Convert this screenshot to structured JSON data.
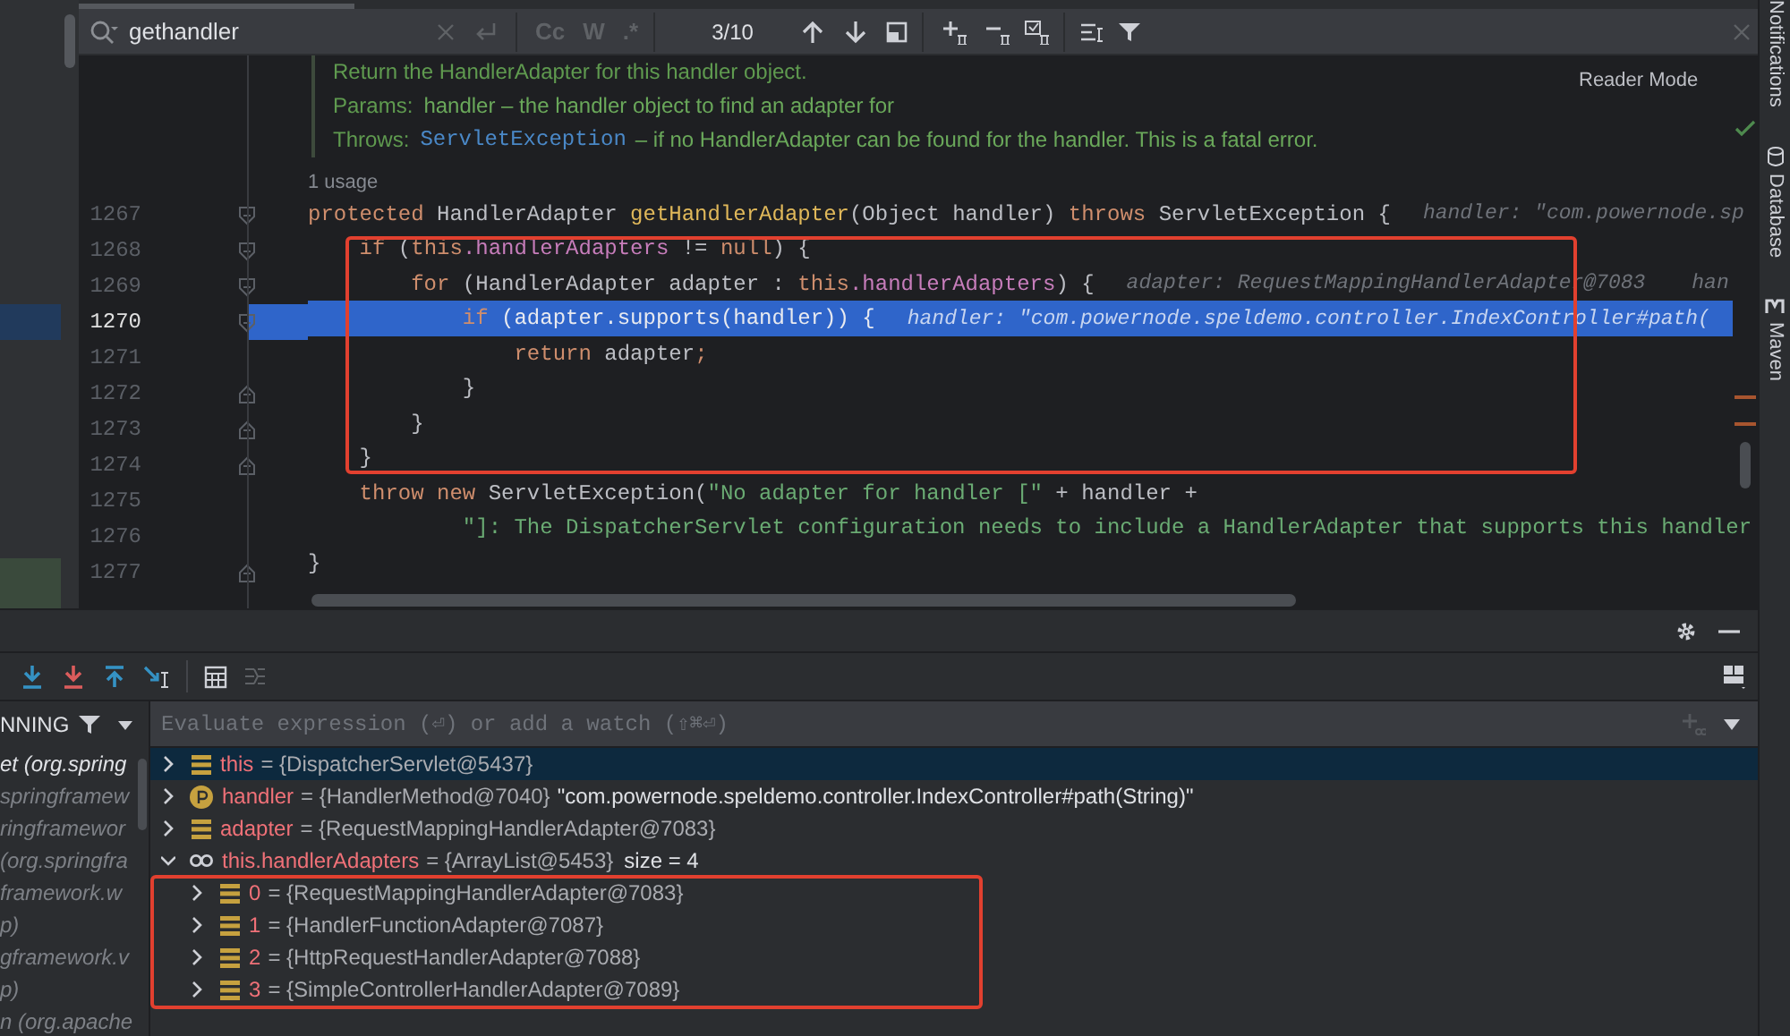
{
  "search": {
    "query": "gethandler",
    "toggles": [
      {
        "label": "Cc",
        "on": false
      },
      {
        "label": "W",
        "on": false
      },
      {
        "label": ".*",
        "on": false
      }
    ],
    "match_count": "3/10"
  },
  "reader_mode": "Reader Mode",
  "doc": {
    "summary": "Return the HandlerAdapter for this handler object.",
    "params_label": "Params:",
    "params_text": "handler – the handler object to find an adapter for",
    "throws_label": "Throws:",
    "throws_link": "ServletException",
    "throws_text": "– if no HandlerAdapter can be found for the handler. This is a fatal error."
  },
  "usages": "1 usage",
  "code_lines": [
    {
      "number": "1267",
      "selected": false,
      "block_start": true,
      "block_end": false,
      "tokens": [
        {
          "kind": "kw",
          "text": "protected "
        },
        {
          "kind": "plain",
          "text": "HandlerAdapter "
        },
        {
          "kind": "method",
          "text": "getHandlerAdapter"
        },
        {
          "kind": "plain",
          "text": "(Object handler) "
        },
        {
          "kind": "kw",
          "text": "throws "
        },
        {
          "kind": "plain",
          "text": "ServletException {"
        },
        {
          "kind": "hint",
          "text": "handler: \"com.powernode.sp"
        }
      ]
    },
    {
      "number": "1268",
      "selected": false,
      "block_start": true,
      "block_end": false,
      "tokens": [
        {
          "kind": "kw",
          "text": "    if "
        },
        {
          "kind": "plain",
          "text": "("
        },
        {
          "kind": "kw",
          "text": "this"
        },
        {
          "kind": "field",
          "text": ".handlerAdapters"
        },
        {
          "kind": "plain",
          "text": " != "
        },
        {
          "kind": "kw",
          "text": "null"
        },
        {
          "kind": "plain",
          "text": ") {"
        }
      ]
    },
    {
      "number": "1269",
      "selected": false,
      "block_start": true,
      "block_end": false,
      "tokens": [
        {
          "kind": "kw",
          "text": "        for "
        },
        {
          "kind": "plain",
          "text": "(HandlerAdapter adapter : "
        },
        {
          "kind": "kw",
          "text": "this"
        },
        {
          "kind": "field",
          "text": ".handlerAdapters"
        },
        {
          "kind": "plain",
          "text": ") {"
        },
        {
          "kind": "hint",
          "text": "adapter: RequestMappingHandlerAdapter@7083"
        },
        {
          "kind": "hint",
          "text": "han"
        }
      ]
    },
    {
      "number": "1270",
      "selected": true,
      "block_start": true,
      "block_end": false,
      "tokens": [
        {
          "kind": "kw",
          "text": "            if "
        },
        {
          "kind": "plain",
          "text": "(adapter.supports(handler)) {"
        },
        {
          "kind": "hint",
          "text": "handler: \"com.powernode.speldemo.controller.IndexController#path("
        }
      ]
    },
    {
      "number": "1271",
      "selected": false,
      "block_start": false,
      "block_end": false,
      "tokens": [
        {
          "kind": "kw",
          "text": "                return "
        },
        {
          "kind": "plain",
          "text": "adapter"
        },
        {
          "kind": "kw",
          "text": ";"
        }
      ]
    },
    {
      "number": "1272",
      "selected": false,
      "block_start": false,
      "block_end": true,
      "tokens": [
        {
          "kind": "plain",
          "text": "            }"
        }
      ]
    },
    {
      "number": "1273",
      "selected": false,
      "block_start": false,
      "block_end": true,
      "tokens": [
        {
          "kind": "plain",
          "text": "        }"
        }
      ]
    },
    {
      "number": "1274",
      "selected": false,
      "block_start": false,
      "block_end": true,
      "tokens": [
        {
          "kind": "plain",
          "text": "    }"
        }
      ]
    },
    {
      "number": "1275",
      "selected": false,
      "block_start": false,
      "block_end": false,
      "tokens": [
        {
          "kind": "kw",
          "text": "    throw new "
        },
        {
          "kind": "plain",
          "text": "ServletException("
        },
        {
          "kind": "str",
          "text": "\"No adapter for handler [\""
        },
        {
          "kind": "plain",
          "text": " + handler +"
        }
      ]
    },
    {
      "number": "1276",
      "selected": false,
      "block_start": false,
      "block_end": false,
      "tokens": [
        {
          "kind": "str",
          "text": "            \"]: The DispatcherServlet configuration needs to include a HandlerAdapter that supports this handler"
        }
      ]
    },
    {
      "number": "1277",
      "selected": false,
      "block_start": false,
      "block_end": true,
      "tokens": [
        {
          "kind": "plain",
          "text": "}"
        }
      ]
    }
  ],
  "side_tabs": [
    {
      "label": "Notifications",
      "kind": "bell"
    },
    {
      "label": "Database",
      "kind": "database"
    },
    {
      "label": "Maven",
      "kind": "maven"
    }
  ],
  "debugger": {
    "frames_header": "NNING",
    "frames": [
      {
        "text": "et (org.spring",
        "selected": true
      },
      {
        "text": "springframew",
        "selected": false
      },
      {
        "text": "ringframewor",
        "selected": false
      },
      {
        "text": "(org.springfra",
        "selected": false
      },
      {
        "text": "framework.w",
        "selected": false
      },
      {
        "text": "p)",
        "selected": false
      },
      {
        "text": "gframework.v",
        "selected": false
      },
      {
        "text": "p)",
        "selected": false
      },
      {
        "text": "n (org.apache",
        "selected": false
      }
    ],
    "watch_placeholder": "Evaluate expression (⏎) or add a watch (⇧⌘⏎)",
    "variables": [
      {
        "kind": "field",
        "name": "this",
        "value": "= {DispatcherServlet@5437}",
        "selected": true,
        "expanded": false
      },
      {
        "kind": "param",
        "name": "handler",
        "value": "= {HandlerMethod@7040}",
        "string": "\"com.powernode.speldemo.controller.IndexController#path(String)\"",
        "selected": false,
        "expanded": false
      },
      {
        "kind": "field",
        "name": "adapter",
        "value": "= {RequestMappingHandlerAdapter@7083}",
        "selected": false,
        "expanded": false
      },
      {
        "kind": "list",
        "name": "this.handlerAdapters",
        "value": "= {ArrayList@5453}",
        "size": "size = 4",
        "selected": false,
        "expanded": true,
        "children": [
          {
            "kind": "field",
            "name": "0",
            "value": "= {RequestMappingHandlerAdapter@7083}",
            "selected": false,
            "expanded": false
          },
          {
            "kind": "field",
            "name": "1",
            "value": "= {HandlerFunctionAdapter@7087}",
            "selected": false,
            "expanded": false
          },
          {
            "kind": "field",
            "name": "2",
            "value": "= {HttpRequestHandlerAdapter@7088}",
            "selected": false,
            "expanded": false
          },
          {
            "kind": "field",
            "name": "3",
            "value": "= {SimpleControllerHandlerAdapter@7089}",
            "selected": false,
            "expanded": false
          }
        ]
      }
    ]
  }
}
